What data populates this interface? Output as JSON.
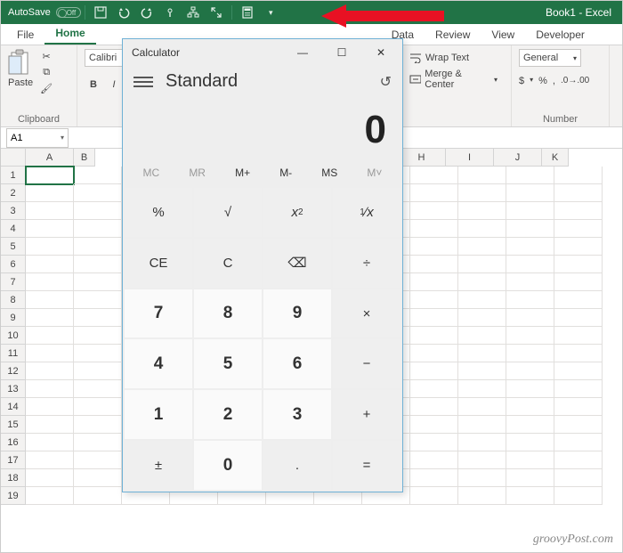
{
  "titlebar": {
    "autosave_label": "AutoSave",
    "autosave_off": "Off",
    "book_title": "Book1 - Excel"
  },
  "tabs": {
    "file": "File",
    "home": "Home",
    "data": "Data",
    "review": "Review",
    "view": "View",
    "developer": "Developer"
  },
  "ribbon": {
    "clipboard_label": "Clipboard",
    "paste_label": "Paste",
    "font_name": "Calibri",
    "bold": "B",
    "italic": "I",
    "wrap_text": "Wrap Text",
    "merge_center": "Merge & Center",
    "number_label": "Number",
    "number_format": "General",
    "currency": "$",
    "percent": "%",
    "comma": ","
  },
  "namebox": {
    "ref": "A1"
  },
  "columns": [
    "A",
    "B",
    "H",
    "I",
    "J",
    "K"
  ],
  "rows": [
    "1",
    "2",
    "3",
    "4",
    "5",
    "6",
    "7",
    "8",
    "9",
    "10",
    "11",
    "12",
    "13",
    "14",
    "15",
    "16",
    "17",
    "18",
    "19"
  ],
  "calc": {
    "title": "Calculator",
    "mode": "Standard",
    "display": "0",
    "mem": {
      "mc": "MC",
      "mr": "MR",
      "mplus": "M+",
      "mminus": "M-",
      "ms": "MS",
      "mlist": "M˅"
    },
    "buttons": {
      "pct": "%",
      "sqrt": "√",
      "sq": "x²",
      "recip": "¹∕ₓ",
      "ce": "CE",
      "c": "C",
      "bksp": "⌫",
      "div": "÷",
      "d7": "7",
      "d8": "8",
      "d9": "9",
      "mul": "×",
      "d4": "4",
      "d5": "5",
      "d6": "6",
      "sub": "−",
      "d1": "1",
      "d2": "2",
      "d3": "3",
      "add": "+",
      "neg": "±",
      "d0": "0",
      "dot": ".",
      "eq": "="
    }
  },
  "watermark": "groovyPost.com"
}
